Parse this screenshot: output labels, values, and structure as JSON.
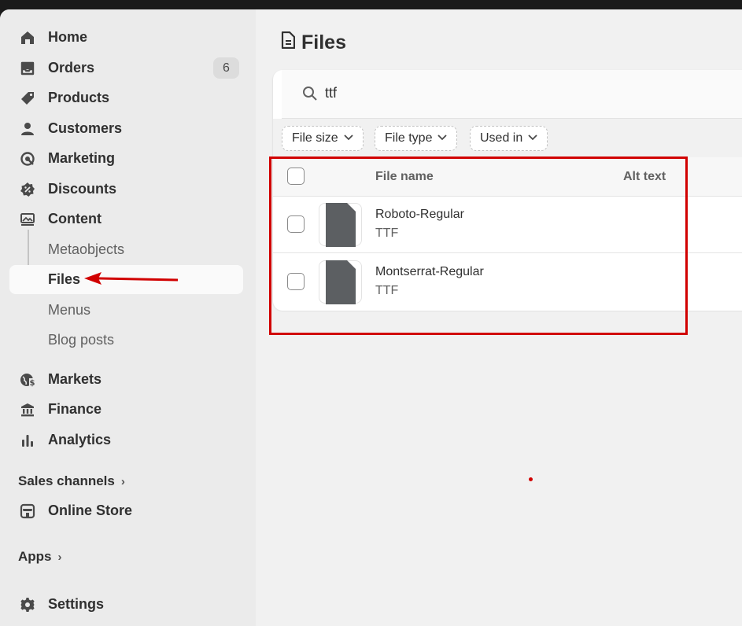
{
  "sidebar": {
    "items": [
      {
        "label": "Home",
        "icon": "home-icon"
      },
      {
        "label": "Orders",
        "icon": "inbox-icon",
        "badge": "6"
      },
      {
        "label": "Products",
        "icon": "tag-icon"
      },
      {
        "label": "Customers",
        "icon": "person-icon"
      },
      {
        "label": "Marketing",
        "icon": "target-icon"
      },
      {
        "label": "Discounts",
        "icon": "discount-icon"
      },
      {
        "label": "Content",
        "icon": "image-icon"
      }
    ],
    "content_sub": [
      {
        "label": "Metaobjects"
      },
      {
        "label": "Files",
        "active": true
      },
      {
        "label": "Menus"
      },
      {
        "label": "Blog posts"
      }
    ],
    "items2": [
      {
        "label": "Markets",
        "icon": "globe-icon"
      },
      {
        "label": "Finance",
        "icon": "bank-icon"
      },
      {
        "label": "Analytics",
        "icon": "bar-chart-icon"
      }
    ],
    "sales_channels": {
      "title": "Sales channels",
      "items": [
        {
          "label": "Online Store",
          "icon": "store-icon"
        }
      ]
    },
    "apps": {
      "title": "Apps"
    },
    "settings": {
      "label": "Settings",
      "icon": "gear-icon"
    }
  },
  "main": {
    "title": "Files",
    "search": {
      "value": "ttf"
    },
    "filters": [
      {
        "label": "File size"
      },
      {
        "label": "File type"
      },
      {
        "label": "Used in"
      }
    ],
    "table": {
      "headers": {
        "name": "File name",
        "alt": "Alt text"
      },
      "rows": [
        {
          "name": "Roboto-Regular",
          "type": "TTF"
        },
        {
          "name": "Montserrat-Regular",
          "type": "TTF"
        }
      ]
    }
  },
  "colors": {
    "annotation_red": "#d10000",
    "sidebar_bg": "#ebebeb",
    "main_bg": "#f1f1f1",
    "text": "#303030"
  }
}
